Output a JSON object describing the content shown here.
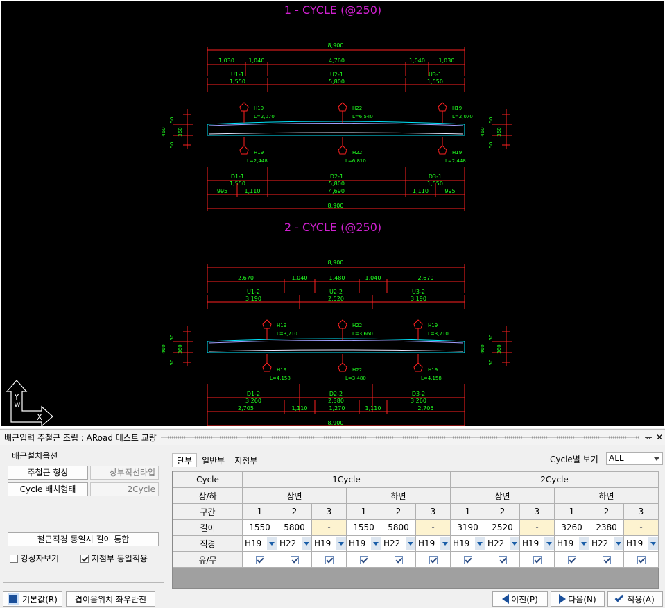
{
  "cad": {
    "cycle1_title": "1 - CYCLE (@250)",
    "cycle2_title": "2 - CYCLE (@250)",
    "cycle1": {
      "top_total": "8,900",
      "top_spans": [
        "1,030",
        "1,040",
        "4,760",
        "1,040",
        "1,030"
      ],
      "top_bars": [
        "U1-1",
        "U2-1",
        "U3-1"
      ],
      "top_lengths": [
        "1,550",
        "5,800",
        "1,550"
      ],
      "top_marks": [
        "H19",
        "H22",
        "H19"
      ],
      "top_L": [
        "L=2,070",
        "L=6,540",
        "L=2,070"
      ],
      "bot_marks": [
        "H19",
        "H22",
        "H19"
      ],
      "bot_L": [
        "L=2,448",
        "L=6,810",
        "L=2,448"
      ],
      "bot_bars": [
        "D1-1",
        "D2-1",
        "D3-1"
      ],
      "bot_lengths": [
        "1,550",
        "5,800",
        "1,550"
      ],
      "bot_spans": [
        "995",
        "1,110",
        "4,690",
        "1,110",
        "995"
      ],
      "bot_total": "8,900",
      "side_top": "50",
      "side_mid": "460",
      "side_inner": "360",
      "side_bot": "50"
    },
    "cycle2": {
      "top_total": "8,900",
      "top_spans": [
        "2,670",
        "1,040",
        "1,480",
        "1,040",
        "2,670"
      ],
      "top_bars": [
        "U1-2",
        "U2-2",
        "U3-2"
      ],
      "top_lengths": [
        "3,190",
        "2,520",
        "3,190"
      ],
      "top_marks": [
        "H19",
        "H22",
        "H19"
      ],
      "top_L": [
        "L=3,710",
        "L=3,660",
        "L=3,710"
      ],
      "bot_marks": [
        "H19",
        "H22",
        "H19"
      ],
      "bot_L": [
        "L=4,158",
        "L=3,480",
        "L=4,158"
      ],
      "bot_bars": [
        "D1-2",
        "D2-2",
        "D3-2"
      ],
      "bot_lengths": [
        "3,260",
        "2,380",
        "3,260"
      ],
      "bot_spans": [
        "2,705",
        "1,110",
        "1,270",
        "1,110",
        "2,705"
      ],
      "bot_total": "8,900",
      "side_top": "50",
      "side_mid": "460",
      "side_inner": "360",
      "side_bot": "50"
    },
    "axis_y": "Y",
    "axis_x": "X",
    "axis_w": "W",
    "colors": {
      "title": "#d020d0",
      "dim": "#ff2020",
      "text": "#20ff20",
      "slab": "#00e8ff",
      "slab2": "#e8e8ff"
    }
  },
  "panel": {
    "title": "배근입력 주철근 조립 : ARoad 테스트 교량",
    "pin": "ᅲ",
    "close": "✕",
    "group_label": "배근설치옵션",
    "shape_button": "주철근 형상",
    "shape_value": "상부직선타입",
    "layout_button": "Cycle 배치형태",
    "layout_value": "2Cycle",
    "merge_button": "철근직경 동일시 길이 통합",
    "check_view": "강상자보기",
    "check_view_on": false,
    "check_support": "지점부 동일적용",
    "check_support_on": true,
    "tabs": [
      "단부",
      "일반부",
      "지점부"
    ],
    "cycle_view_label": "Cycle별 보기",
    "cycle_view_value": "ALL"
  },
  "grid": {
    "row_labels": [
      "Cycle",
      "상/하",
      "구간",
      "길이",
      "직경",
      "유/무"
    ],
    "cycles": [
      "1Cycle",
      "2Cycle"
    ],
    "faces": [
      "상면",
      "하면",
      "상면",
      "하면"
    ],
    "segments": [
      "1",
      "2",
      "3",
      "1",
      "2",
      "3",
      "1",
      "2",
      "3",
      "1",
      "2",
      "3"
    ],
    "lengths": [
      "1550",
      "5800",
      "-",
      "1550",
      "5800",
      "-",
      "3190",
      "2520",
      "-",
      "3260",
      "2380",
      "-"
    ],
    "diameters": [
      "H19",
      "H22",
      "H19",
      "H19",
      "H22",
      "H19",
      "H19",
      "H22",
      "H19",
      "H19",
      "H22",
      "H19"
    ]
  },
  "footer": {
    "default_button": "기본값(R)",
    "flip_button": "겹이음위치 좌우반전",
    "prev_button": "이전(P)",
    "next_button": "다음(N)",
    "apply_button": "적용(A)"
  }
}
